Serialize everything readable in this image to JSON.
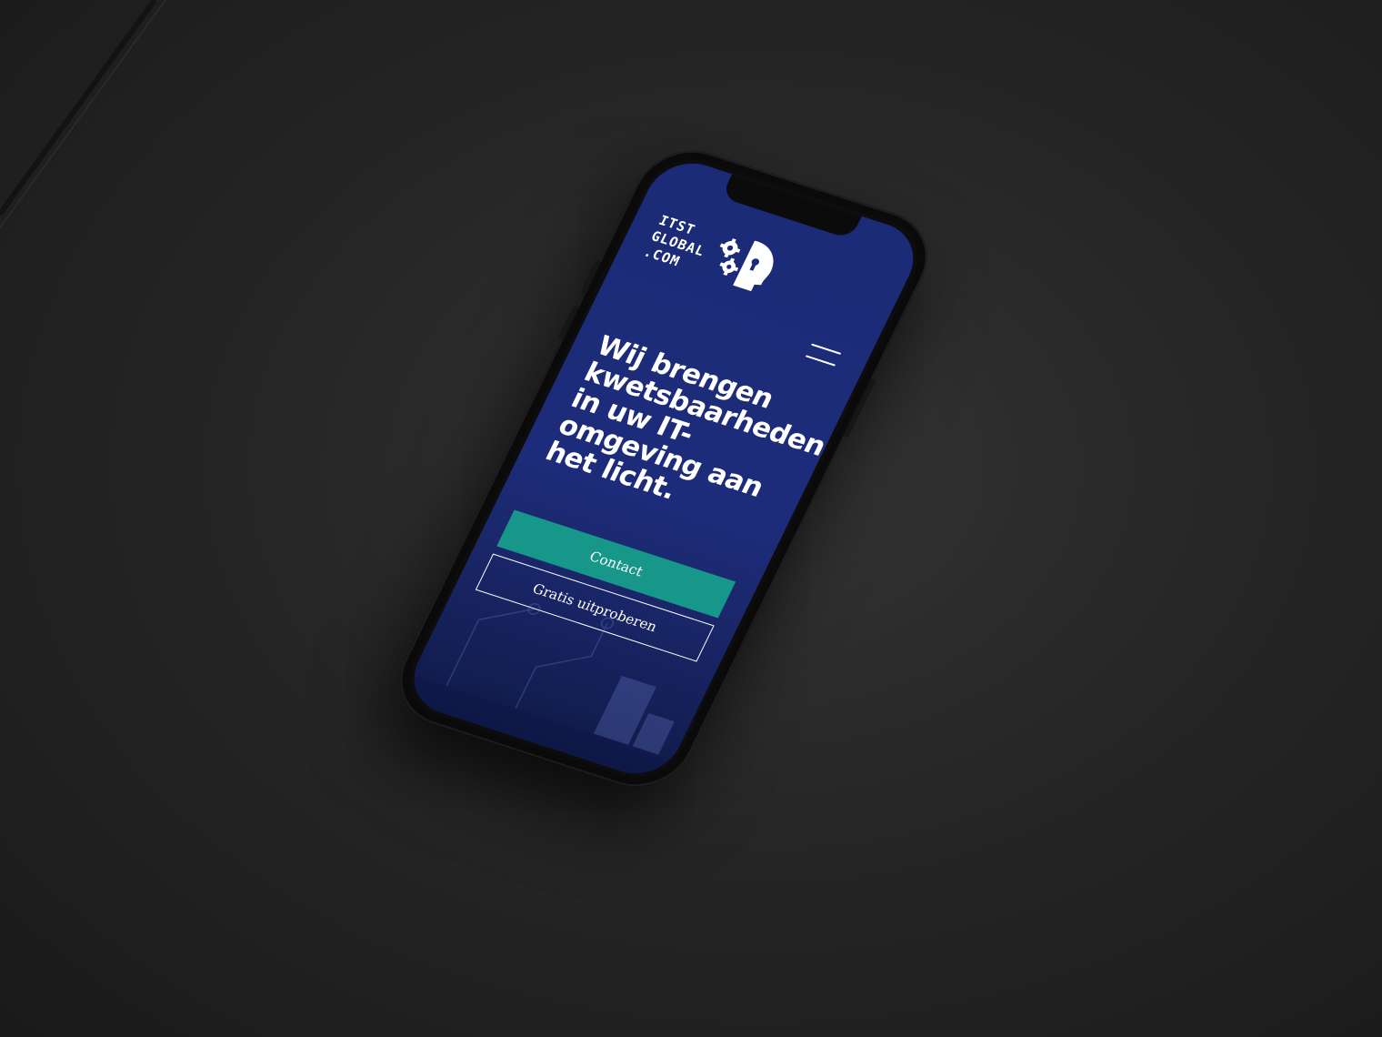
{
  "site": {
    "logo_lines": [
      "ITST",
      "GLOBAL",
      ".COM"
    ]
  },
  "hero": {
    "title": "Wij brengen kwetsbaarheden in uw IT-omgeving aan het licht."
  },
  "buttons": {
    "contact": "Contact",
    "trial": "Gratis uitproberen"
  },
  "colors": {
    "screen_background": "#1c2b78",
    "accent": "#17968a",
    "text": "#ffffff",
    "device": "#0d0d0d"
  },
  "icons": {
    "logo_mark": "gears-head-lock-icon",
    "menu": "hamburger-menu-icon"
  }
}
